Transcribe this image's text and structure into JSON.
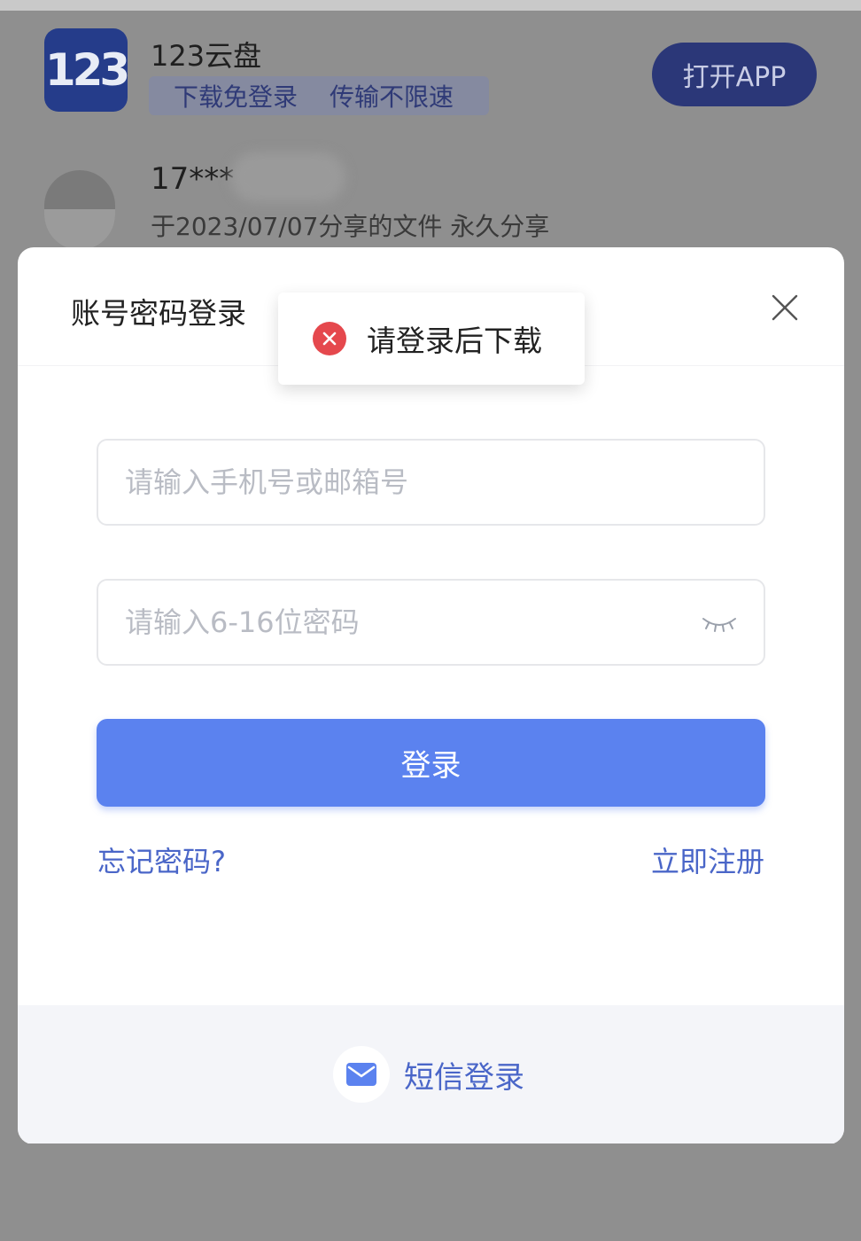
{
  "header": {
    "logo_text": "123",
    "app_name": "123云盘",
    "tag_1": "下载免登录",
    "tag_2": "传输不限速",
    "open_app_label": "打开APP"
  },
  "share": {
    "user": "17***",
    "info": "于2023/07/07分享的文件 永久分享"
  },
  "modal": {
    "title": "账号密码登录",
    "account_placeholder": "请输入手机号或邮箱号",
    "password_placeholder": "请输入6-16位密码",
    "login_label": "登录",
    "forgot_label": "忘记密码?",
    "register_label": "立即注册",
    "sms_login_label": "短信登录"
  },
  "toast": {
    "message": "请登录后下载"
  },
  "colors": {
    "primary": "#5b82ef",
    "link": "#4a66c8",
    "error": "#e5484d",
    "overlay_bg": "#8f8f8f"
  },
  "icons": {
    "close": "close-icon",
    "eye": "eye-closed-icon",
    "error": "error-circle-icon",
    "mail": "mail-icon"
  }
}
